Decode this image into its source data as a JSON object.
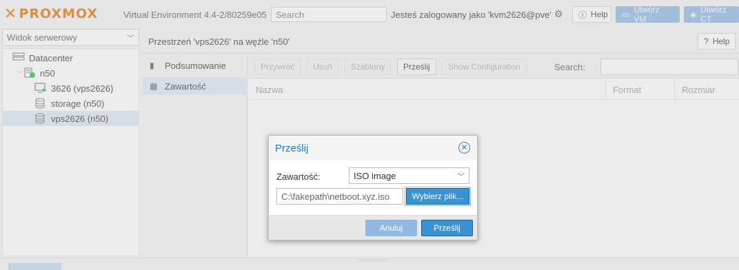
{
  "header": {
    "logo": "PROXMOX",
    "version": "Virtual Environment 4.4-2/80259e05",
    "search_placeholder": "Search",
    "login_text": "Jesteś zalogowany jako 'kvm2626@pve'",
    "help_label": "Help",
    "create_vm_label": "Utwórz VM",
    "create_ct_label": "Utwórz CT"
  },
  "sidebar": {
    "view_selector": "Widok serwerowy",
    "tree": [
      {
        "label": "Datacenter",
        "icon": "datacenter-icon"
      },
      {
        "label": "n50",
        "icon": "server-icon"
      },
      {
        "label": "3626 (vps2626)",
        "icon": "vm-icon"
      },
      {
        "label": "storage (n50)",
        "icon": "storage-icon"
      },
      {
        "label": "vps2626 (n50)",
        "icon": "storage-icon",
        "selected": true
      }
    ]
  },
  "main": {
    "title": "Przestrzeń 'vps2626' na węźle 'n50'",
    "help_label": "Help",
    "nav": [
      {
        "label": "Podsumowanie",
        "icon": "book-icon"
      },
      {
        "label": "Zawartość",
        "icon": "grid-icon",
        "selected": true
      }
    ],
    "toolbar": {
      "restore": "Przywróć",
      "remove": "Usuń",
      "templates": "Szablony",
      "upload": "Prześlij",
      "show_config": "Show Configuration",
      "search_label": "Search:"
    },
    "columns": [
      "Nazwa",
      "Format",
      "Rozmiar"
    ]
  },
  "dialog": {
    "title": "Prześlij",
    "content_label": "Zawartość:",
    "content_value": "ISO image",
    "file_value": "C:\\fakepath\\netboot.xyz.iso",
    "browse_label": "Wybierz plik...",
    "cancel_label": "Anuluj",
    "upload_label": "Prześlij"
  },
  "colors": {
    "accent": "#3892d4",
    "brand": "#e57000",
    "selection": "#dfe8f6"
  }
}
